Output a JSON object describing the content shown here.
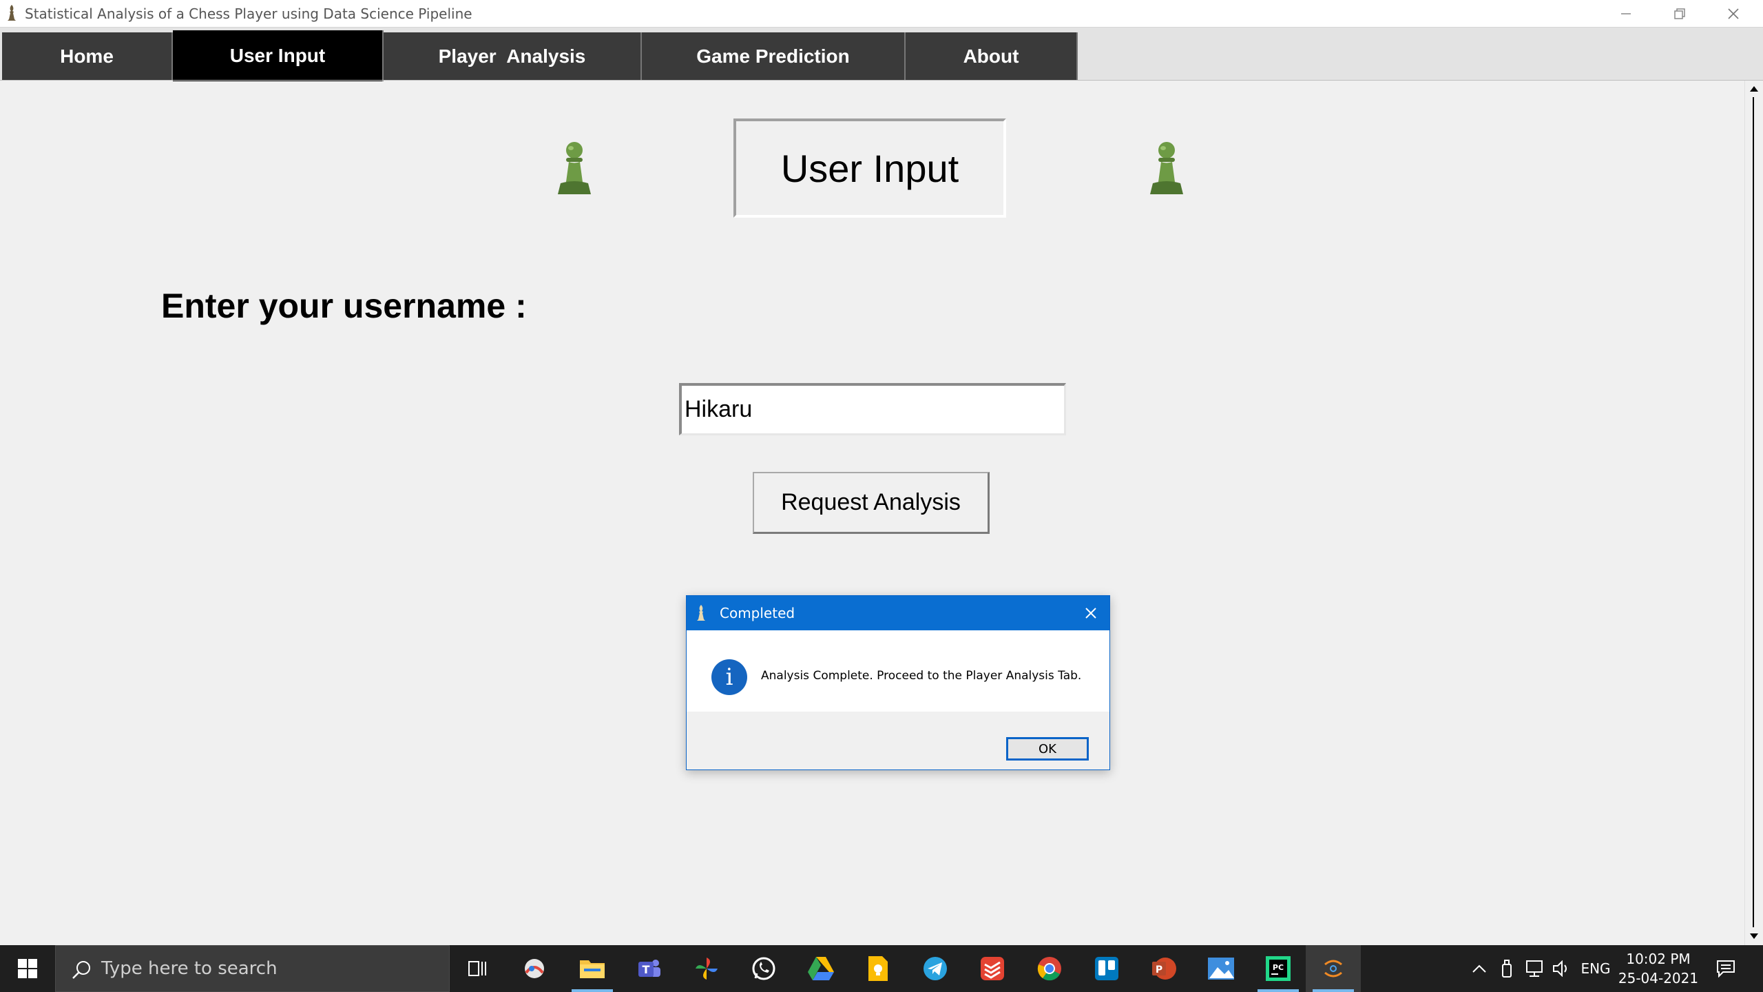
{
  "window": {
    "title": "Statistical Analysis of a Chess Player using Data Science Pipeline",
    "controls": [
      "minimize-icon",
      "restore-icon",
      "close-icon"
    ]
  },
  "tabs": [
    {
      "label": "Home",
      "active": false
    },
    {
      "label": "User Input",
      "active": true
    },
    {
      "label": "Player  Analysis",
      "active": false
    },
    {
      "label": "Game Prediction",
      "active": false
    },
    {
      "label": "About",
      "active": false
    }
  ],
  "main": {
    "heading": "User Input",
    "prompt": "Enter your username :",
    "username_value": "Hikaru",
    "request_button": "Request Analysis"
  },
  "dialog": {
    "title": "Completed",
    "message": "Analysis Complete. Proceed to the Player Analysis Tab.",
    "ok_label": "OK"
  },
  "taskbar": {
    "search_placeholder": "Type here to search",
    "language": "ENG",
    "time": "10:02 PM",
    "date": "25-04-2021"
  },
  "colors": {
    "pawn_green": "#5f8a3c",
    "dialog_title_bg": "#0a6ed1",
    "tab_active": "#000000",
    "tab_inactive": "#3a3a3a"
  }
}
